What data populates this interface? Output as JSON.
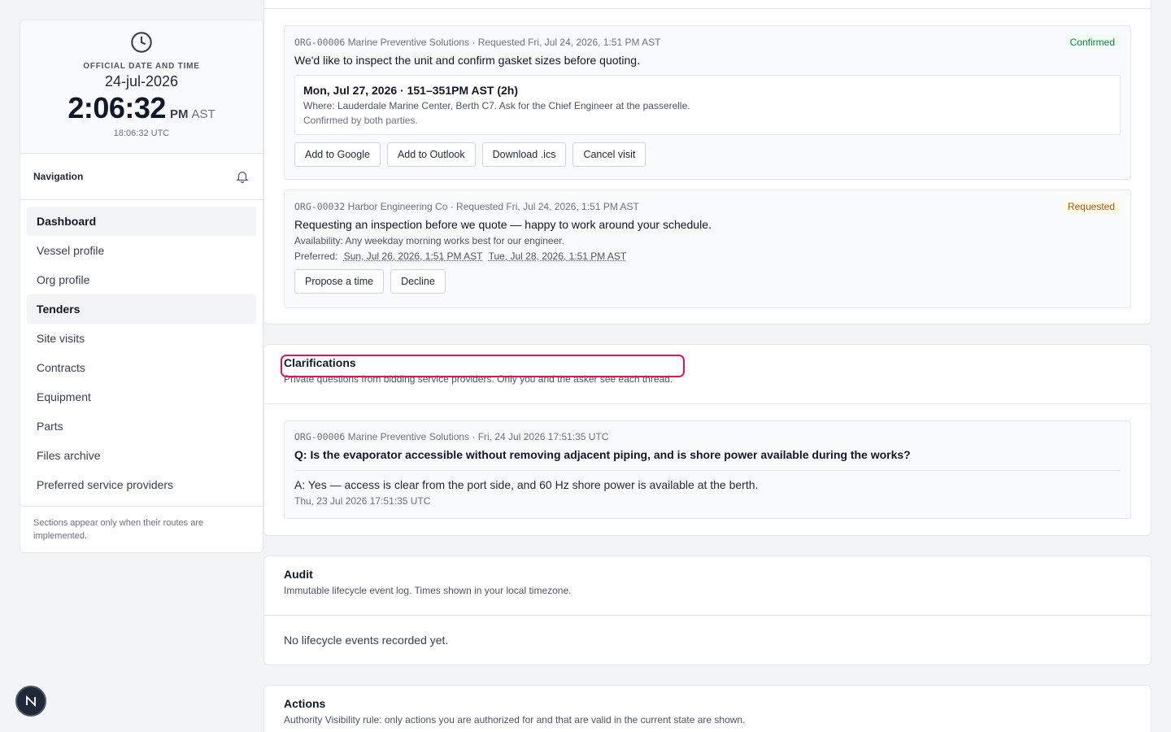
{
  "clock": {
    "label": "OFFICIAL DATE AND TIME",
    "date": "24-jul-2026",
    "time": "2:06:32",
    "ampm": "PM",
    "tz": "AST",
    "utc": "18:06:32 UTC"
  },
  "nav": {
    "title": "Navigation",
    "items": [
      {
        "label": "Dashboard"
      },
      {
        "label": "Vessel profile"
      },
      {
        "label": "Org profile"
      },
      {
        "label": "Tenders"
      },
      {
        "label": "Site visits"
      },
      {
        "label": "Contracts"
      },
      {
        "label": "Equipment"
      },
      {
        "label": "Parts"
      },
      {
        "label": "Files archive"
      },
      {
        "label": "Preferred service providers"
      }
    ],
    "note": "Sections appear only when their routes are implemented."
  },
  "visits": [
    {
      "org_code": "ORG-00006",
      "meta": " Marine Preventive Solutions · Requested Fri, Jul 24, 2026, 1:51 PM AST",
      "status": "Confirmed",
      "message": "We'd like to inspect the unit and confirm gasket sizes before quoting.",
      "slot_title": "Mon, Jul 27, 2026 · 151–351PM AST (2h)",
      "where": "Where: Lauderdale Marine Center, Berth C7. Ask for the Chief Engineer at the passerelle.",
      "confirmed_note": "Confirmed by both parties.",
      "buttons": [
        "Add to Google",
        "Add to Outlook",
        "Download .ics",
        "Cancel visit"
      ]
    },
    {
      "org_code": "ORG-00032",
      "meta": " Harbor Engineering Co · Requested Fri, Jul 24, 2026, 1:51 PM AST",
      "status": "Requested",
      "message": "Requesting an inspection before we quote — happy to work around your schedule.",
      "availability": "Availability: Any weekday morning works best for our engineer.",
      "preferred_label": "Preferred:",
      "preferred": [
        "Sun, Jul 26, 2026, 1:51 PM AST",
        "Tue, Jul 28, 2026, 1:51 PM AST"
      ],
      "buttons": [
        "Propose a time",
        "Decline"
      ]
    }
  ],
  "clarifications": {
    "title": "Clarifications",
    "subtitle": "Private questions from bidding service providers. Only you and the asker see each thread.",
    "thread": {
      "org_code": "ORG-00006",
      "meta": " Marine Preventive Solutions · Fri, 24 Jul 2026 17:51:35 UTC",
      "question": "Q: Is the evaporator accessible without removing adjacent piping, and is shore power available during the works?",
      "answer": "A: Yes — access is clear from the port side, and 60 Hz shore power is available at the berth.",
      "answer_time": "Thu, 23 Jul 2026 17:51:35 UTC"
    }
  },
  "audit": {
    "title": "Audit",
    "subtitle": "Immutable lifecycle event log. Times shown in your local timezone.",
    "empty": "No lifecycle events recorded yet."
  },
  "actions": {
    "title": "Actions",
    "subtitle": "Authority Visibility rule: only actions you are authorized for and that are valid in the current state are shown."
  },
  "fab": {
    "label": "N"
  },
  "colors": {
    "highlight": "#d6185f",
    "confirmed": "#15803d",
    "requested": "#b45309"
  }
}
